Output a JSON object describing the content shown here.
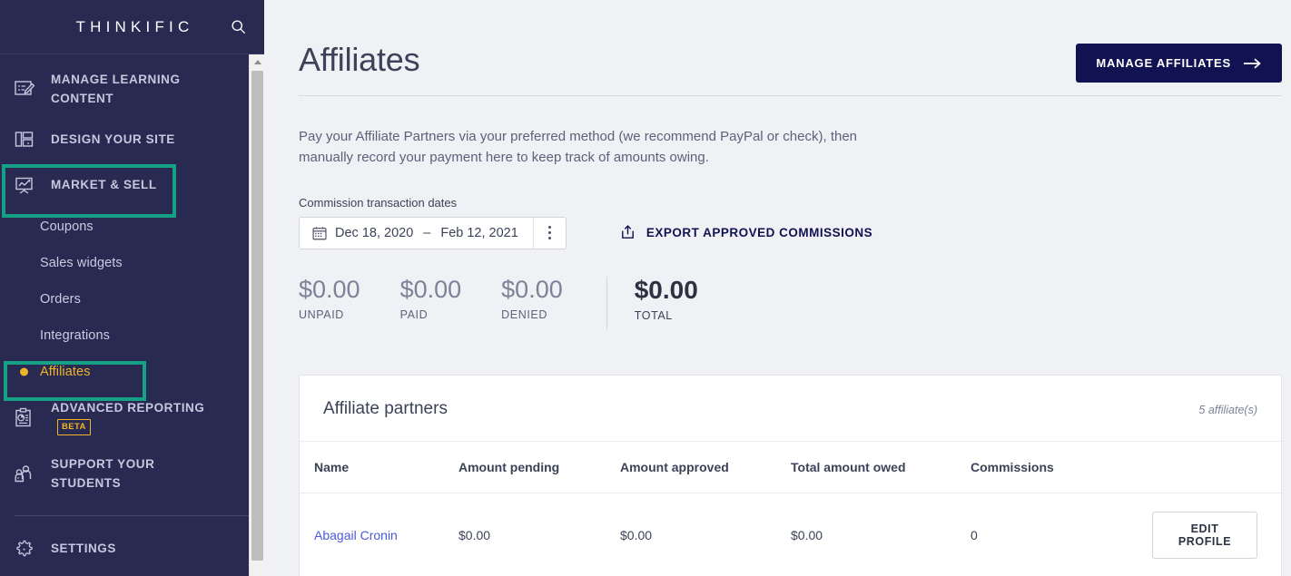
{
  "sidebar": {
    "brand": "THINKIFIC",
    "search_icon": "search-icon",
    "items": [
      {
        "label": "MANAGE LEARNING CONTENT",
        "icon": "edit-document-icon"
      },
      {
        "label": "DESIGN YOUR SITE",
        "icon": "layout-icon"
      },
      {
        "label": "MARKET & SELL",
        "icon": "chart-presentation-icon",
        "highlighted": true
      }
    ],
    "subitems": [
      {
        "label": "Coupons",
        "active": false
      },
      {
        "label": "Sales widgets",
        "active": false
      },
      {
        "label": "Orders",
        "active": false
      },
      {
        "label": "Integrations",
        "active": false
      },
      {
        "label": "Affiliates",
        "active": true,
        "highlighted": true
      }
    ],
    "items_lower": [
      {
        "label": "ADVANCED REPORTING",
        "icon": "clipboard-chart-icon",
        "badge": "BETA"
      },
      {
        "label": "SUPPORT YOUR STUDENTS",
        "icon": "people-icon"
      }
    ],
    "settings": {
      "label": "SETTINGS",
      "icon": "gear-icon"
    },
    "highlight_color": "#16a085",
    "active_color": "#f0b429"
  },
  "main": {
    "title": "Affiliates",
    "manage_button": "MANAGE AFFILIATES",
    "manage_button_icon": "arrow-right-icon",
    "intro": "Pay your Affiliate Partners via your preferred method (we recommend PayPal or check), then manually record your payment here to keep track of amounts owing.",
    "filters": {
      "label": "Commission transaction dates",
      "calendar_icon": "calendar-icon",
      "date_start": "Dec 18, 2020",
      "date_separator": "–",
      "date_end": "Feb 12, 2021",
      "kebab_icon": "kebab-menu-icon",
      "export_label": "EXPORT APPROVED COMMISSIONS",
      "export_icon": "upload-icon"
    },
    "stats": [
      {
        "value": "$0.00",
        "label": "UNPAID"
      },
      {
        "value": "$0.00",
        "label": "PAID"
      },
      {
        "value": "$0.00",
        "label": "DENIED"
      }
    ],
    "stat_total": {
      "value": "$0.00",
      "label": "TOTAL"
    },
    "card": {
      "title": "Affiliate partners",
      "count": "5 affiliate(s)",
      "columns": [
        "Name",
        "Amount pending",
        "Amount approved",
        "Total amount owed",
        "Commissions"
      ],
      "rows": [
        {
          "name": "Abagail Cronin",
          "amount_pending": "$0.00",
          "amount_approved": "$0.00",
          "total_amount_owed": "$0.00",
          "commissions": "0",
          "action": "EDIT PROFILE"
        }
      ]
    }
  }
}
